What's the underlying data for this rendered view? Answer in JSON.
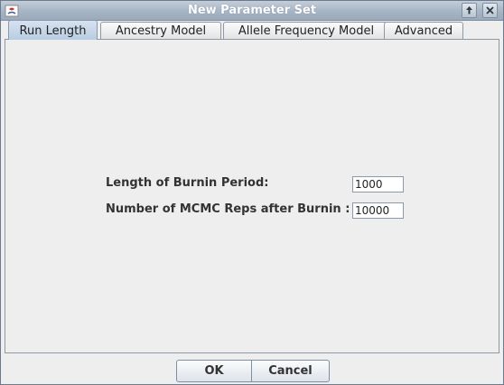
{
  "window": {
    "title": "New Parameter Set"
  },
  "tabs": [
    {
      "label": "Run Length",
      "selected": true
    },
    {
      "label": "Ancestry Model",
      "selected": false
    },
    {
      "label": "Allele Frequency Model",
      "selected": false
    },
    {
      "label": "Advanced",
      "selected": false
    }
  ],
  "run_length": {
    "burnin_label": "Length of Burnin Period:",
    "burnin_value": "1000",
    "mcmc_label": "Number of MCMC Reps after Burnin :",
    "mcmc_value": "10000"
  },
  "buttons": {
    "ok_label": "OK",
    "cancel_label": "Cancel"
  },
  "icons": {
    "app": "java-app-icon",
    "maximize": "maximize-icon",
    "close": "close-icon"
  },
  "colors": {
    "titlebar": "#a8b6c6",
    "selected_tab": "#b9cce2",
    "background": "#eeeeee"
  }
}
